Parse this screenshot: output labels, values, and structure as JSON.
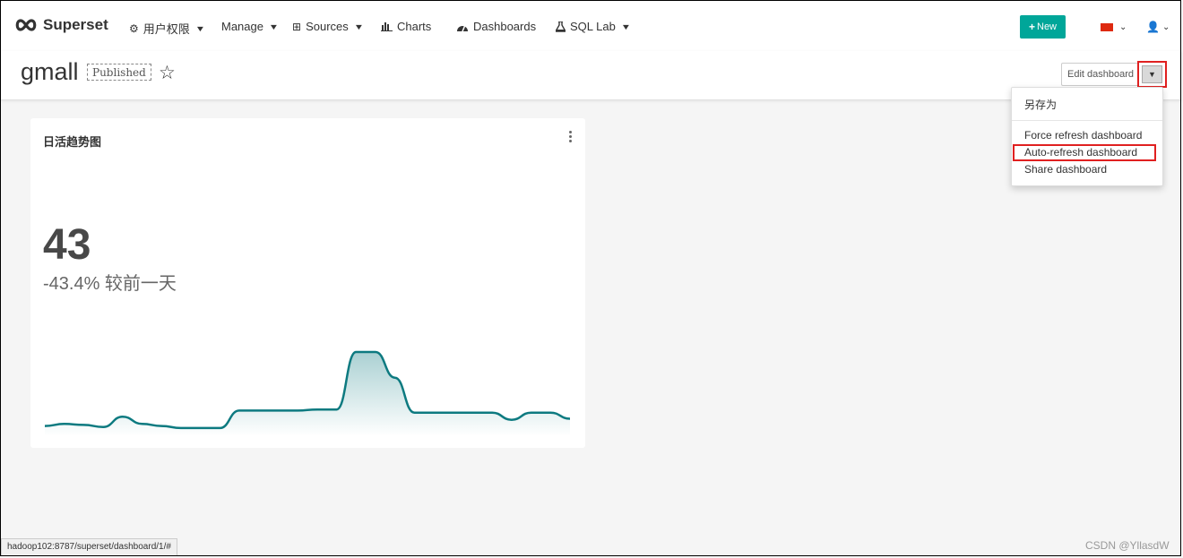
{
  "navbar": {
    "brand": "Superset",
    "items": [
      {
        "icon": "gears-icon",
        "label": "用户权限",
        "caret": true
      },
      {
        "icon": "",
        "label": "Manage",
        "caret": true
      },
      {
        "icon": "table-icon",
        "label": "Sources",
        "caret": true
      },
      {
        "icon": "bar-chart-icon",
        "label": "Charts",
        "caret": false
      },
      {
        "icon": "dashboard-icon",
        "label": "Dashboards",
        "caret": false
      },
      {
        "icon": "flask-icon",
        "label": "SQL Lab",
        "caret": true
      }
    ],
    "new_button": "New",
    "colors": {
      "accent": "#00a699",
      "flag": "#de2910"
    }
  },
  "header": {
    "title": "gmall",
    "status_badge": "Published",
    "edit_button": "Edit dashboard"
  },
  "menu": {
    "items": [
      "另存为",
      "Force refresh dashboard",
      "Auto-refresh dashboard",
      "Share dashboard"
    ],
    "highlighted": "Auto-refresh dashboard"
  },
  "card": {
    "title": "日活趋势图",
    "big_number": "43",
    "subheader": "-43.4% 较前一天",
    "trend_color": "#0d7a80"
  },
  "chart_data": {
    "type": "area",
    "title": "日活趋势图",
    "values": [
      3,
      5,
      4,
      2,
      12,
      5,
      3,
      1,
      1,
      1,
      18,
      18,
      18,
      18,
      19,
      19,
      75,
      75,
      50,
      16,
      16,
      16,
      16,
      16,
      9,
      16,
      16,
      10
    ],
    "big_number": 43,
    "delta_percent": -43.4
  },
  "status_bar": {
    "url": "hadoop102:8787/superset/dashboard/1/#"
  },
  "watermark": "CSDN @YllasdW"
}
